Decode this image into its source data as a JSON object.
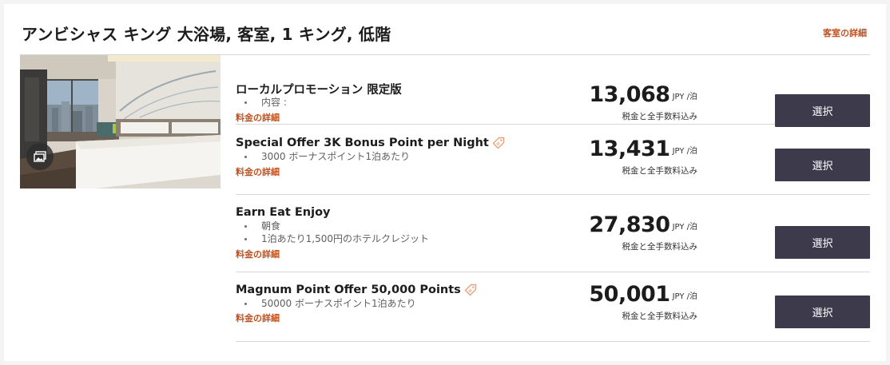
{
  "room": {
    "title": "アンビシャス キング 大浴場, 客室, 1 キング, 低階",
    "details_link": "客室の詳細"
  },
  "rates": [
    {
      "name": "ローカルプロモーション 限定版",
      "tag_icon": false,
      "bullets": [
        "内容 :"
      ],
      "details_link": "料金の詳細",
      "price": "13,068",
      "unit": "JPY /泊",
      "note": "税金と全手数料込み",
      "button": "選択"
    },
    {
      "name": "Special Offer 3K Bonus Point per Night",
      "tag_icon": true,
      "bullets": [
        "3000 ボーナスポイント1泊あたり"
      ],
      "details_link": "料金の詳細",
      "price": "13,431",
      "unit": "JPY /泊",
      "note": "税金と全手数料込み",
      "button": "選択"
    },
    {
      "name": "Earn Eat Enjoy",
      "tag_icon": false,
      "bullets": [
        "朝食",
        "1泊あたり1,500円のホテルクレジット"
      ],
      "details_link": "料金の詳細",
      "price": "27,830",
      "unit": "JPY /泊",
      "note": "税金と全手数料込み",
      "button": "選択"
    },
    {
      "name": "Magnum Point Offer 50,000 Points",
      "tag_icon": true,
      "bullets": [
        "50000 ボーナスポイント1泊あたり"
      ],
      "details_link": "料金の詳細",
      "price": "50,001",
      "unit": "JPY /泊",
      "note": "税金と全手数料込み",
      "button": "選択"
    }
  ],
  "icons": {
    "gallery": "photo-gallery-icon",
    "tag": "tag-icon"
  },
  "colors": {
    "accent_link": "#c0501e",
    "button_bg": "#3d3a4c",
    "tag_icon": "#e8a07a"
  }
}
